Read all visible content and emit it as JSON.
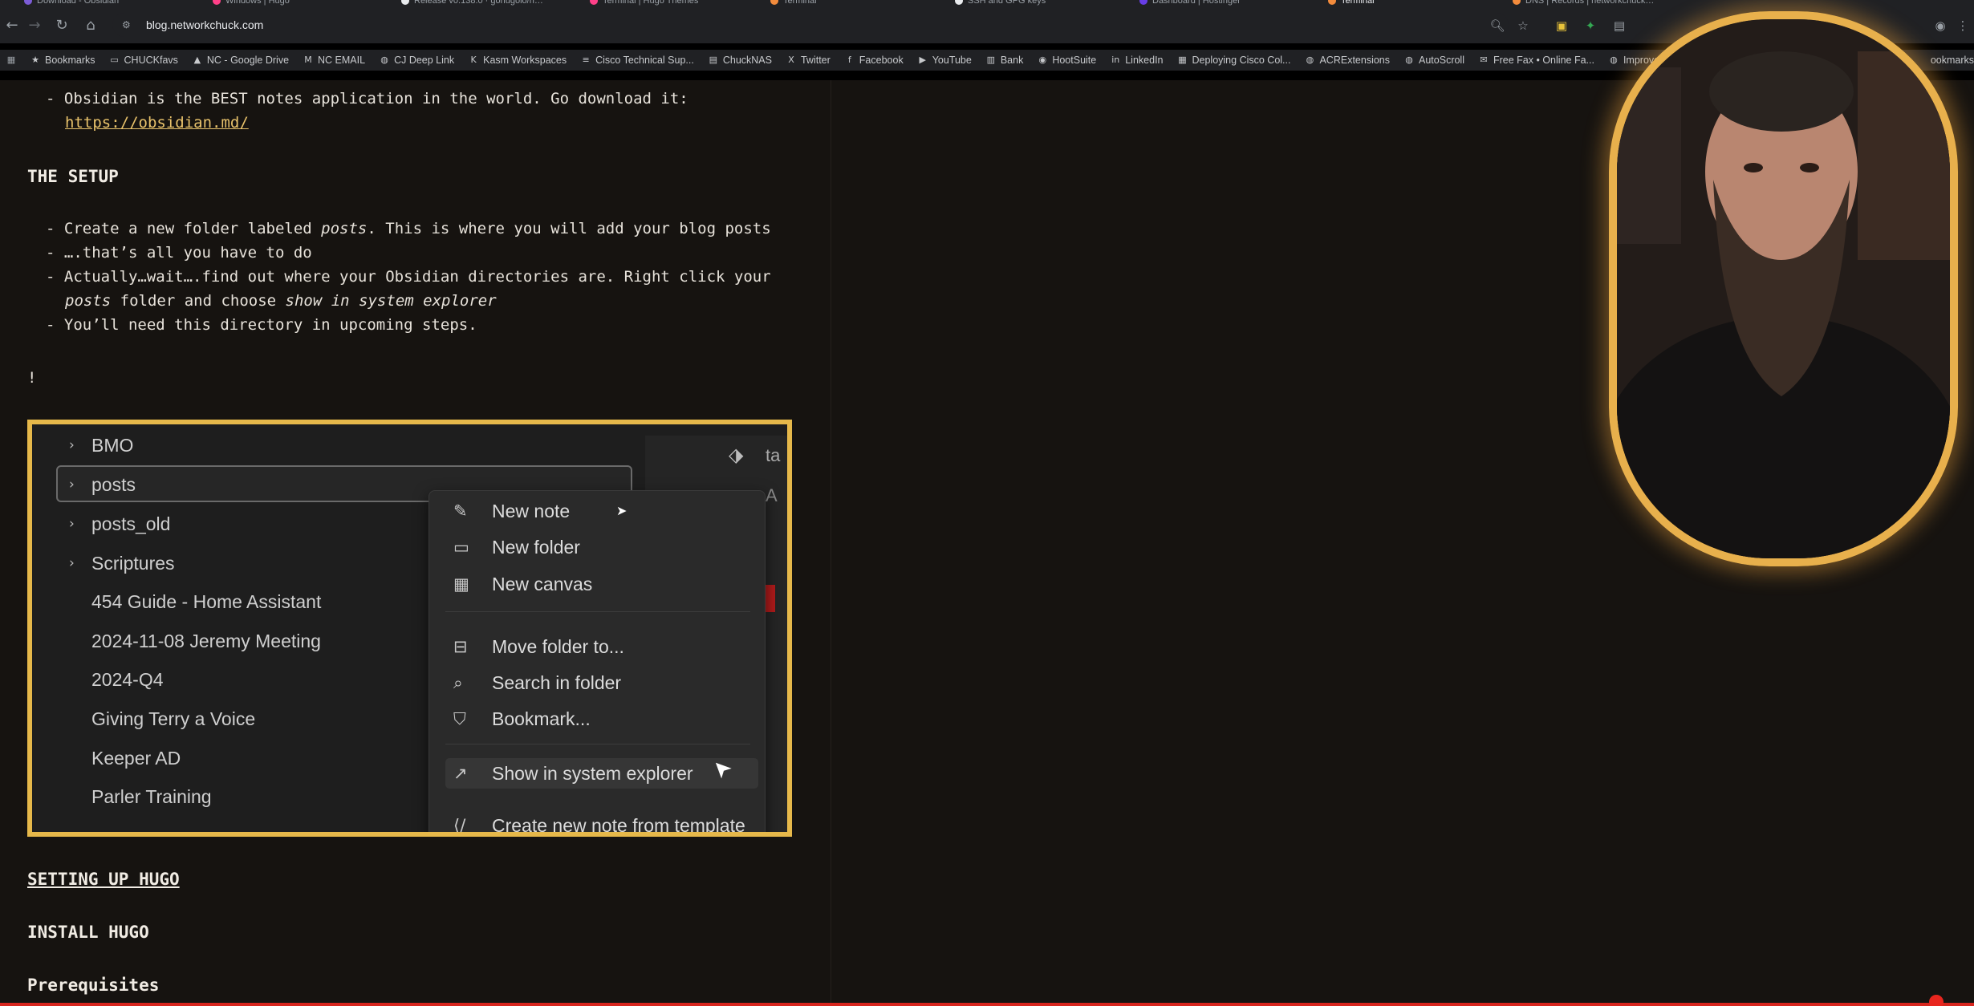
{
  "browser": {
    "tabs": [
      {
        "title": "Download - Obsidian",
        "color": "#7c5cd6"
      },
      {
        "title": "Windows | Hugo",
        "color": "#ff4088"
      },
      {
        "title": "Release v0.138.0 · gohugoio/h…",
        "color": "#e8eaed"
      },
      {
        "title": "Terminal | Hugo Themes",
        "color": "#ff4088"
      },
      {
        "title": "Terminal",
        "color": "#f28b3c"
      },
      {
        "title": "SSH and GPG keys",
        "color": "#e8eaed"
      },
      {
        "title": "Dashboard | Hostinger",
        "color": "#673de6"
      },
      {
        "title": "Terminal",
        "color": "#f28b3c",
        "active": true
      },
      {
        "title": "DNS | Records | networkchuck…",
        "color": "#f28b3c"
      }
    ],
    "url": "blog.networkchuck.com",
    "bookmarks": [
      {
        "label": "Bookmarks",
        "icon": "star-icon"
      },
      {
        "label": "CHUCKfavs",
        "icon": "folder-icon"
      },
      {
        "label": "NC - Google Drive",
        "icon": "drive-icon"
      },
      {
        "label": "NC EMAIL",
        "icon": "mail-icon"
      },
      {
        "label": "CJ Deep Link",
        "icon": "globe-icon"
      },
      {
        "label": "Kasm Workspaces",
        "icon": "kasm-icon"
      },
      {
        "label": "Cisco Technical Sup...",
        "icon": "cisco-icon"
      },
      {
        "label": "ChuckNAS",
        "icon": "nas-icon"
      },
      {
        "label": "Twitter",
        "icon": "x-icon"
      },
      {
        "label": "Facebook",
        "icon": "facebook-icon"
      },
      {
        "label": "YouTube",
        "icon": "youtube-icon"
      },
      {
        "label": "Bank",
        "icon": "bank-icon"
      },
      {
        "label": "HootSuite",
        "icon": "hootsuite-icon"
      },
      {
        "label": "LinkedIn",
        "icon": "linkedin-icon"
      },
      {
        "label": "Deploying Cisco Col...",
        "icon": "doc-icon"
      },
      {
        "label": "ACRExtensions",
        "icon": "globe-icon"
      },
      {
        "label": "AutoScroll",
        "icon": "globe-icon"
      },
      {
        "label": "Free Fax • Online Fa...",
        "icon": "fax-icon"
      },
      {
        "label": "Improve the Wind...",
        "icon": "globe-icon"
      }
    ],
    "bookmarks_overflow": "ookmarks"
  },
  "content": {
    "obsidian_line1": "- Obsidian is the BEST notes application in the world. Go download it:",
    "obsidian_link": "https://obsidian.md/",
    "setup_heading": "THE SETUP",
    "setup_b1_pre": "- Create a new folder labeled ",
    "setup_b1_em": "posts",
    "setup_b1_post": ". This is where you will add your blog posts",
    "setup_b2": "- ….that’s all you have to do",
    "setup_b3_line1": "- Actually…wait….find out where your Obsidian directories are. Right click your",
    "setup_b3_em1": "posts",
    "setup_b3_mid": " folder and choose ",
    "setup_b3_em2": "show in system explorer",
    "setup_b4": "- You’ll need this directory in upcoming steps.",
    "image_placeholder": "!",
    "hugo_heading": "SETTING UP HUGO",
    "install_heading": "INSTALL HUGO",
    "prereq_heading": "Prerequisites"
  },
  "obsidian": {
    "tree": [
      {
        "label": "BMO",
        "folder": true
      },
      {
        "label": "posts",
        "folder": true,
        "selected": true
      },
      {
        "label": "posts_old",
        "folder": true
      },
      {
        "label": "Scriptures",
        "folder": true
      },
      {
        "label": "454 Guide - Home Assistant",
        "folder": false
      },
      {
        "label": "2024-11-08 Jeremy Meeting",
        "folder": false
      },
      {
        "label": "2024-Q4",
        "folder": false
      },
      {
        "label": "Giving Terry a Voice",
        "folder": false
      },
      {
        "label": "Keeper AD",
        "folder": false
      },
      {
        "label": "Parler Training",
        "folder": false
      }
    ],
    "right_pane_text": "ta",
    "right_pane_text2": "A",
    "menu": [
      {
        "label": "New note",
        "icon": "edit-icon"
      },
      {
        "label": "New folder",
        "icon": "folder-open-icon"
      },
      {
        "label": "New canvas",
        "icon": "canvas-icon"
      },
      {
        "label": "Move folder to...",
        "icon": "move-icon"
      },
      {
        "label": "Search in folder",
        "icon": "search-folder-icon"
      },
      {
        "label": "Bookmark...",
        "icon": "bookmark-icon"
      },
      {
        "label": "Show in system explorer",
        "icon": "arrow-up-right-icon",
        "highlighted": true
      },
      {
        "label": "Create new note from template",
        "icon": "template-icon"
      }
    ]
  },
  "colors": {
    "page_bg": "#161310",
    "accent_frame": "#e6b84a",
    "link": "#e8c26b",
    "progress_bar": "#d7261e"
  }
}
